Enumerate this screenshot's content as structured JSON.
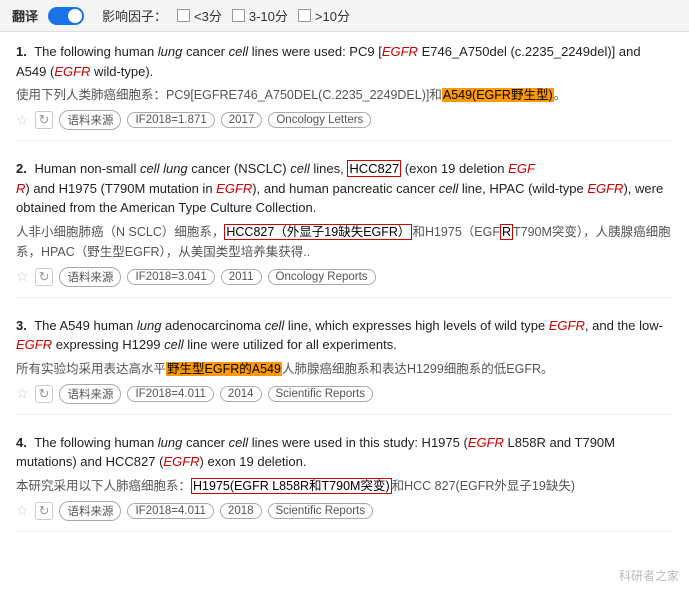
{
  "topbar": {
    "toggle_label": "翻译",
    "filter_label": "影响因子：",
    "filters": [
      {
        "label": "<3分",
        "checked": false
      },
      {
        "label": "3-10分",
        "checked": false
      },
      {
        "label": ">10分",
        "checked": false
      }
    ]
  },
  "results": [
    {
      "num": "1.",
      "en_parts": [
        {
          "text": "The following human ",
          "type": "normal"
        },
        {
          "text": "lung",
          "type": "italic"
        },
        {
          "text": " cancer ",
          "type": "normal"
        },
        {
          "text": "cell",
          "type": "italic"
        },
        {
          "text": " lines were used: PC9 [",
          "type": "normal"
        },
        {
          "text": "EGFR",
          "type": "gene"
        },
        {
          "text": " E746_A750del (c.2235_2249del)] and A549 (",
          "type": "normal"
        },
        {
          "text": "EGFR",
          "type": "gene"
        },
        {
          "text": " wild-type).",
          "type": "normal"
        }
      ],
      "zh_parts": [
        {
          "text": "使用下列人类肺癌细胞系：PC9[EGFRE746_A750DEL(C.2235_2249DEL)]和",
          "type": "normal"
        },
        {
          "text": "A549(EGFR野生型)",
          "type": "highlight-orange"
        },
        {
          "text": "。",
          "type": "normal"
        }
      ],
      "meta": {
        "source": "语料来源",
        "if": "IF2018=1.871",
        "year": "2017",
        "journal": "Oncology Letters"
      }
    },
    {
      "num": "2.",
      "en_parts": [
        {
          "text": "Human non-small ",
          "type": "normal"
        },
        {
          "text": "cell lung",
          "type": "italic"
        },
        {
          "text": " cancer (NSCLC) ",
          "type": "normal"
        },
        {
          "text": "cell",
          "type": "italic"
        },
        {
          "text": " lines, ",
          "type": "normal"
        },
        {
          "text": "HCC827",
          "type": "highlight-red-border"
        },
        {
          "text": " (exon 19 deletion ",
          "type": "normal"
        },
        {
          "text": "EGF\nR",
          "type": "gene"
        },
        {
          "text": ") and H1975 (T790M mutation in ",
          "type": "normal"
        },
        {
          "text": "EGFR",
          "type": "gene"
        },
        {
          "text": "), and human pancreatic cancer ",
          "type": "normal"
        },
        {
          "text": "cell",
          "type": "italic"
        },
        {
          "text": " line, HPAC (wild-type ",
          "type": "normal"
        },
        {
          "text": "EGFR",
          "type": "gene"
        },
        {
          "text": "), were obtained from the American Type Culture Collection.",
          "type": "normal"
        }
      ],
      "zh_parts": [
        {
          "text": "人非小细胞肺癌（N SCLC）细胞系，",
          "type": "normal"
        },
        {
          "text": "HCC827（外显子19缺失EGFR）",
          "type": "highlight-red-border"
        },
        {
          "text": "和H1975（EGF",
          "type": "normal"
        },
        {
          "text": "R",
          "type": "highlight-red-border-inline"
        },
        {
          "text": "T790M突变），人胰腺癌细胞系，HPAC（野生型EGFR），从美国类型培养集获得..",
          "type": "normal"
        }
      ],
      "meta": {
        "source": "语料来源",
        "if": "IF2018=3.041",
        "year": "2011",
        "journal": "Oncology Reports"
      }
    },
    {
      "num": "3.",
      "en_parts": [
        {
          "text": "The A549 human ",
          "type": "normal"
        },
        {
          "text": "lung",
          "type": "italic"
        },
        {
          "text": " adenocarcinoma ",
          "type": "normal"
        },
        {
          "text": "cell",
          "type": "italic"
        },
        {
          "text": " line, which expresses high levels of wild type ",
          "type": "normal"
        },
        {
          "text": "EGFR",
          "type": "gene"
        },
        {
          "text": ", and the low-",
          "type": "normal"
        },
        {
          "text": "EGFR",
          "type": "gene"
        },
        {
          "text": " expressing H1299 ",
          "type": "normal"
        },
        {
          "text": "cell",
          "type": "italic"
        },
        {
          "text": " line were utilized for all experiments.",
          "type": "normal"
        }
      ],
      "zh_parts": [
        {
          "text": "所有实验均采用表达高水平",
          "type": "normal"
        },
        {
          "text": "野生型EGFR的A549",
          "type": "highlight-orange"
        },
        {
          "text": "人肺腺癌细胞系和表达H1299细胞系的低EGFR。",
          "type": "normal"
        }
      ],
      "meta": {
        "source": "语料来源",
        "if": "IF2018=4.011",
        "year": "2014",
        "journal": "Scientific Reports"
      }
    },
    {
      "num": "4.",
      "en_parts": [
        {
          "text": "The following human ",
          "type": "normal"
        },
        {
          "text": "lung",
          "type": "italic"
        },
        {
          "text": " cancer ",
          "type": "normal"
        },
        {
          "text": "cell",
          "type": "italic"
        },
        {
          "text": " lines were used in this study: H1975 (",
          "type": "normal"
        },
        {
          "text": "EGFR",
          "type": "gene"
        },
        {
          "text": " L858R and T790M mutations) and HCC827 (",
          "type": "normal"
        },
        {
          "text": "EGFR",
          "type": "gene"
        },
        {
          "text": ") exon 19 deletion.",
          "type": "normal"
        }
      ],
      "zh_parts": [
        {
          "text": "本研究采用以下人肺癌细胞系：",
          "type": "normal"
        },
        {
          "text": "H1975(EGFR L858R和T790M突变)",
          "type": "highlight-red-border"
        },
        {
          "text": "和HCC 827(EGFR外显子19缺失)",
          "type": "normal"
        }
      ],
      "meta": {
        "source": "语料来源",
        "if": "IF2018=4.011",
        "year": "2018",
        "journal": "Scientific Reports"
      }
    }
  ],
  "watermark": "科研者之家"
}
